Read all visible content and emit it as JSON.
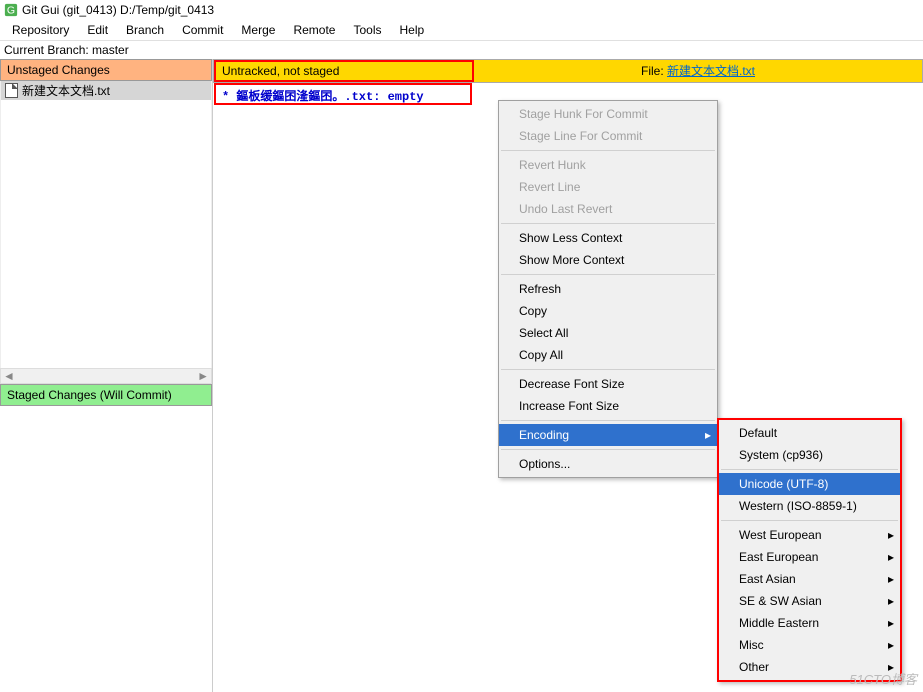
{
  "title": "Git Gui (git_0413) D:/Temp/git_0413",
  "menubar": [
    "Repository",
    "Edit",
    "Branch",
    "Commit",
    "Merge",
    "Remote",
    "Tools",
    "Help"
  ],
  "branch_line": "Current Branch: master",
  "panels": {
    "unstaged_header": "Unstaged Changes",
    "staged_header": "Staged Changes (Will Commit)",
    "unstaged_files": [
      "新建文本文档.txt"
    ]
  },
  "diff": {
    "status": "Untracked, not staged",
    "file_label": "File:",
    "file_name": "新建文本文档.txt",
    "content_line": "* 鏂板缓鏂囨湰鏂囨。.txt: empty"
  },
  "context_menu": {
    "items": [
      {
        "label": "Stage Hunk For Commit",
        "disabled": true
      },
      {
        "label": "Stage Line For Commit",
        "disabled": true
      },
      {
        "sep": true
      },
      {
        "label": "Revert Hunk",
        "disabled": true
      },
      {
        "label": "Revert Line",
        "disabled": true
      },
      {
        "label": "Undo Last Revert",
        "disabled": true
      },
      {
        "sep": true
      },
      {
        "label": "Show Less Context"
      },
      {
        "label": "Show More Context"
      },
      {
        "sep": true
      },
      {
        "label": "Refresh"
      },
      {
        "label": "Copy"
      },
      {
        "label": "Select All"
      },
      {
        "label": "Copy All"
      },
      {
        "sep": true
      },
      {
        "label": "Decrease Font Size"
      },
      {
        "label": "Increase Font Size"
      },
      {
        "sep": true
      },
      {
        "label": "Encoding",
        "submenu": true,
        "hl": true
      },
      {
        "sep": true
      },
      {
        "label": "Options..."
      }
    ],
    "encoding_submenu": [
      {
        "label": "Default"
      },
      {
        "label": "System (cp936)"
      },
      {
        "sep": true
      },
      {
        "label": "Unicode (UTF-8)",
        "hl": true
      },
      {
        "label": "Western (ISO-8859-1)"
      },
      {
        "sep": true
      },
      {
        "label": "West European",
        "submenu": true
      },
      {
        "label": "East European",
        "submenu": true
      },
      {
        "label": "East Asian",
        "submenu": true
      },
      {
        "label": "SE & SW Asian",
        "submenu": true
      },
      {
        "label": "Middle Eastern",
        "submenu": true
      },
      {
        "label": "Misc",
        "submenu": true
      },
      {
        "label": "Other",
        "submenu": true
      }
    ]
  },
  "watermark": "51CTO博客"
}
